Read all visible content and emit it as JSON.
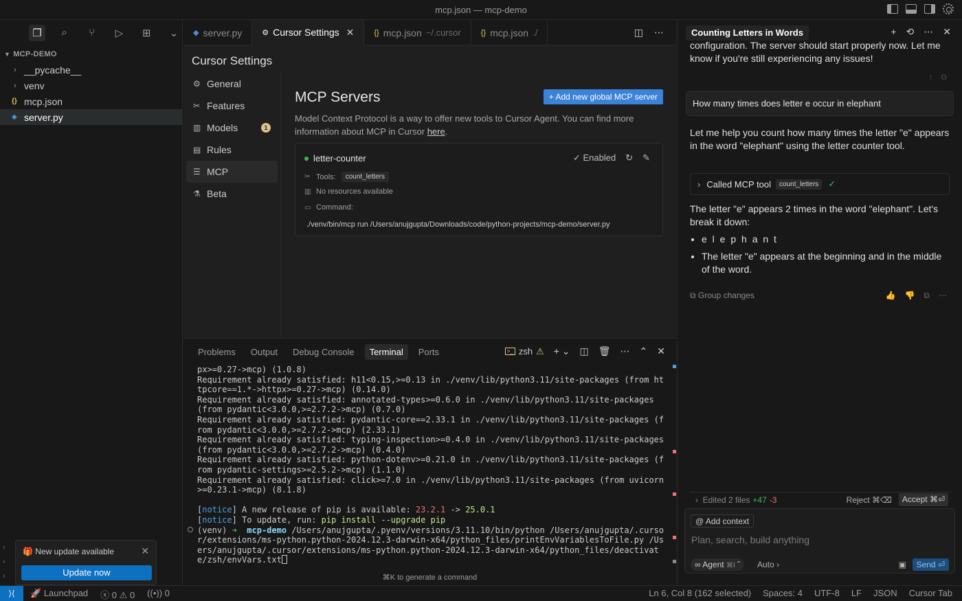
{
  "window": {
    "title": "mcp.json — mcp-demo"
  },
  "explorer": {
    "root": "MCP-DEMO",
    "items": [
      {
        "label": "__pycache__",
        "type": "folder"
      },
      {
        "label": "venv",
        "type": "folder"
      },
      {
        "label": "mcp.json",
        "type": "json",
        "icon": "{}"
      },
      {
        "label": "server.py",
        "type": "py",
        "icon": "py"
      }
    ]
  },
  "update_toast": {
    "message": "New update available",
    "button": "Update now"
  },
  "editor_tabs": [
    {
      "label": "server.py",
      "sub": ""
    },
    {
      "label": "Cursor Settings",
      "sub": ""
    },
    {
      "label": "mcp.json",
      "sub": "~/.cursor"
    },
    {
      "label": "mcp.json",
      "sub": "./"
    }
  ],
  "settings": {
    "title": "Cursor Settings",
    "nav": [
      {
        "label": "General",
        "icon": "⚙"
      },
      {
        "label": "Features",
        "icon": "✂"
      },
      {
        "label": "Models",
        "icon": "▥",
        "badge": "1"
      },
      {
        "label": "Rules",
        "icon": "▤"
      },
      {
        "label": "MCP",
        "icon": "☰"
      },
      {
        "label": "Beta",
        "icon": "⚗"
      }
    ],
    "mcp": {
      "heading": "MCP Servers",
      "add_button": "+ Add new global MCP server",
      "desc_main": "Model Context Protocol is a way to offer new tools to Cursor Agent. You can find more information about MCP in Cursor ",
      "desc_link": "here",
      "desc_end": ".",
      "server": {
        "name": "letter-counter",
        "status": "Enabled",
        "tools_label": "Tools:",
        "tool": "count_letters",
        "resources": "No resources available",
        "command_label": "Command:",
        "command": "./venv/bin/mcp run /Users/anujgupta/Downloads/code/python-projects/mcp-demo/server.py"
      }
    }
  },
  "panel": {
    "tabs": [
      "Problems",
      "Output",
      "Debug Console",
      "Terminal",
      "Ports"
    ],
    "shell": "zsh",
    "hint": "⌘K to generate a command",
    "lines": [
      "px>=0.27->mcp) (1.0.8)",
      "Requirement already satisfied: h11<0.15,>=0.13 in ./venv/lib/python3.11/site-packages (from httpcore==1.*->httpx>=0.27->mcp) (0.14.0)",
      "Requirement already satisfied: annotated-types>=0.6.0 in ./venv/lib/python3.11/site-packages (from pydantic<3.0.0,>=2.7.2->mcp) (0.7.0)",
      "Requirement already satisfied: pydantic-core==2.33.1 in ./venv/lib/python3.11/site-packages (from pydantic<3.0.0,>=2.7.2->mcp) (2.33.1)",
      "Requirement already satisfied: typing-inspection>=0.4.0 in ./venv/lib/python3.11/site-packages (from pydantic<3.0.0,>=2.7.2->mcp) (0.4.0)",
      "Requirement already satisfied: python-dotenv>=0.21.0 in ./venv/lib/python3.11/site-packages (from pydantic-settings>=2.5.2->mcp) (1.1.0)",
      "Requirement already satisfied: click>=7.0 in ./venv/lib/python3.11/site-packages (from uvicorn>=0.23.1->mcp) (8.1.8)"
    ],
    "notice1": {
      "tag": "notice",
      "text": " A new release of pip is available: ",
      "old": "23.2.1",
      "arrow": " -> ",
      "new": "25.0.1"
    },
    "notice2": {
      "tag": "notice",
      "text": " To update, run: ",
      "cmd": "pip install --upgrade pip"
    },
    "prompt": {
      "venv": "(venv) ",
      "arrow": "➜  ",
      "dir": "mcp-demo",
      "cmd": " /Users/anujgupta/.pyenv/versions/3.11.10/bin/python /Users/anujgupta/.cursor/extensions/ms-python.python-2024.12.3-darwin-x64/python_files/printEnvVariablesToFile.py /Users/anujgupta/.cursor/extensions/ms-python.python-2024.12.3-darwin-x64/python_files/deactivate/zsh/envVars.txt"
    }
  },
  "chat": {
    "title": "Counting Letters in Words",
    "prev_tail": "configuration. The server should start properly now. Let me know if you're still experiencing any issues!",
    "user_msg": "How many times does letter e occur in elephant",
    "reply1": "Let me help you count how many times the letter \"e\" appears in the word \"elephant\" using the letter counter tool.",
    "tool_call": {
      "label": "Called MCP tool",
      "tool": "count_letters"
    },
    "reply2": "The letter \"e\" appears 2 times in the word \"elephant\". Let's break it down:",
    "bullets": [
      "e l e p h a n t",
      "The letter \"e\" appears at the beginning and in the middle of the word."
    ],
    "group_changes": "Group changes",
    "edited": {
      "label": "Edited 2 files",
      "plus": "+47",
      "minus": "-3",
      "reject": "Reject ⌘⌫",
      "accept": "Accept ⌘⏎"
    },
    "composer": {
      "add_context": "@ Add context",
      "placeholder": "Plan, search, build anything",
      "agent": "∞ Agent",
      "agent_key": "⌘I",
      "model": "Auto",
      "send": "Send ⏎"
    }
  },
  "statusbar": {
    "launchpad": "Launchpad",
    "errors": "0",
    "warnings": "0",
    "ports": "0",
    "position": "Ln 6, Col 8 (162 selected)",
    "spaces": "Spaces: 4",
    "encoding": "UTF-8",
    "eol": "LF",
    "language": "JSON",
    "cursor_tab": "Cursor Tab"
  }
}
